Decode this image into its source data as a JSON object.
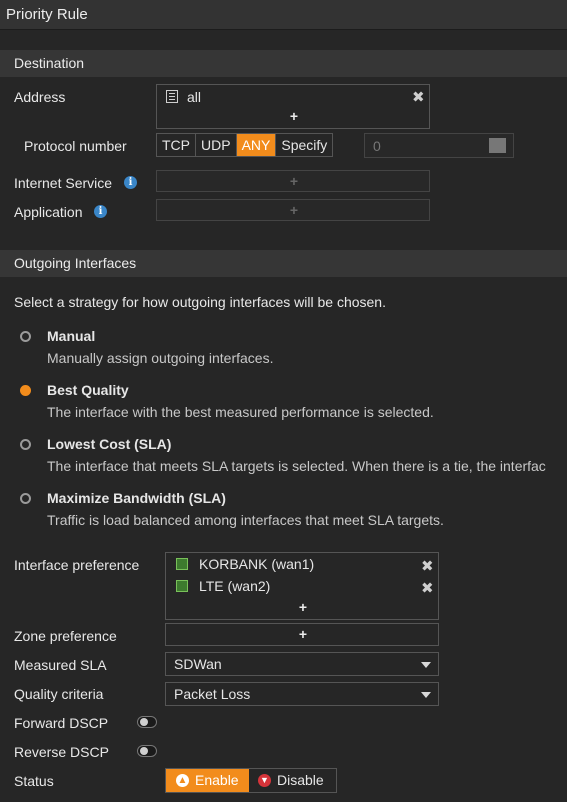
{
  "title": "Priority Rule",
  "destination": {
    "section_title": "Destination",
    "address_label": "Address",
    "address_entry": "all",
    "protocol_label": "Protocol number",
    "protocol_options": [
      "TCP",
      "UDP",
      "ANY",
      "Specify"
    ],
    "protocol_selected": "ANY",
    "protocol_number_value": "0",
    "internet_service_label": "Internet Service",
    "application_label": "Application",
    "add_symbol": "+"
  },
  "outgoing": {
    "section_title": "Outgoing Interfaces",
    "intro": "Select a strategy for how outgoing interfaces will be chosen.",
    "strategies": [
      {
        "title": "Manual",
        "desc": "Manually assign outgoing interfaces.",
        "selected": false
      },
      {
        "title": "Best Quality",
        "desc": "The interface with the best measured performance is selected.",
        "selected": true
      },
      {
        "title": "Lowest Cost (SLA)",
        "desc": "The interface that meets SLA targets is selected. When there is a tie, the interfac",
        "selected": false
      },
      {
        "title": "Maximize Bandwidth (SLA)",
        "desc": "Traffic is load balanced among interfaces that meet SLA targets.",
        "selected": false
      }
    ],
    "interface_preference_label": "Interface preference",
    "interfaces": [
      "KORBANK (wan1)",
      "LTE (wan2)"
    ],
    "zone_preference_label": "Zone preference",
    "measured_sla_label": "Measured SLA",
    "measured_sla_value": "SDWan",
    "quality_criteria_label": "Quality criteria",
    "quality_criteria_value": "Packet Loss",
    "forward_dscp_label": "Forward DSCP",
    "forward_dscp_enabled": false,
    "reverse_dscp_label": "Reverse DSCP",
    "reverse_dscp_enabled": false,
    "status_label": "Status",
    "status_enable": "Enable",
    "status_disable": "Disable",
    "status_selected": "Enable"
  },
  "colors": {
    "accent": "#f28c1c",
    "info": "#3a86c8",
    "background": "#262626"
  },
  "icons": {
    "remove": "close-icon",
    "info": "info-icon",
    "address": "address-icon",
    "interface": "wan-interface-icon"
  }
}
